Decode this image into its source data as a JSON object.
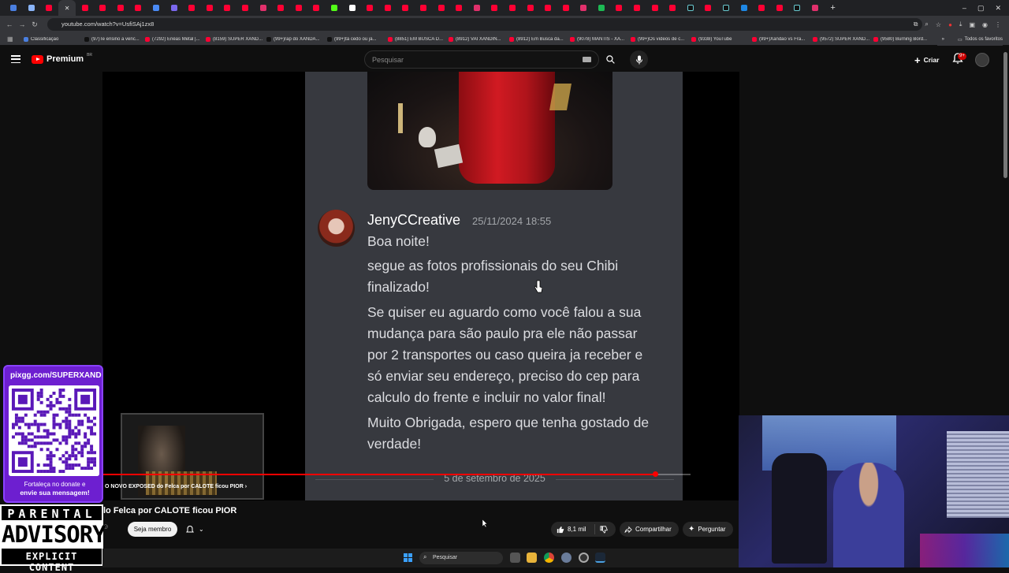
{
  "browser": {
    "tabs": [
      "chrome",
      "bm",
      "yt",
      "close",
      "yt",
      "yt",
      "yt",
      "yt",
      "doc",
      "insta",
      "yt",
      "yt",
      "yt",
      "yt",
      "ig",
      "yt",
      "yt",
      "yt",
      "k",
      "white",
      "yt",
      "yt",
      "yt",
      "yt",
      "yt",
      "yt",
      "ig",
      "yt",
      "yt",
      "yt",
      "yt",
      "yt",
      "ig",
      "green",
      "yt",
      "yt",
      "yt",
      "yt",
      "tiktok",
      "yt",
      "tiktok",
      "blue",
      "yt",
      "yt",
      "tiktok",
      "ig"
    ],
    "new_tab_label": "+",
    "window_controls": [
      "–",
      "▢",
      "✕"
    ],
    "url": "youtube.com/watch?v=UsfiSAj1zx8",
    "bookmarks": [
      "Classificação",
      "(97)Te ensino a venc...",
      "(7292) Enéas Metal |...",
      "(8159) SUPER XAND...",
      "(99+)rap do XANDÃ...",
      "(99+)tá cedo ou já...",
      "(8851) EM BUSCA D...",
      "(8912) VAI XANDIN...",
      "(8912) Em Busca da...",
      "(9078) MANTIS - XA...",
      "(99+)Os vídeos de c...",
      "(9338) YouTube",
      "(99+)Xandão vs Fra...",
      "(9572) SUPER XAND...",
      "(9580) Burning Bord..."
    ],
    "all_bookmarks": "Todos os favoritos"
  },
  "youtube": {
    "logo_text": "Premium",
    "logo_region": "BR",
    "search_placeholder": "Pesquisar",
    "create_label": "Criar",
    "notification_badge": "9+"
  },
  "video": {
    "chat": {
      "username": "JenyCCreative",
      "timestamp": "25/11/2024 18:55",
      "lines": [
        "Boa noite!",
        "segue as fotos profissionais do seu Chibi",
        "finalizado!",
        "Se quiser eu aguardo como você falou a sua",
        "mudança para são paulo pra ele não passar",
        "por 2 transportes ou caso queira ja receber e",
        "só enviar seu endereço, preciso do cep para",
        "calculo do frente e incluir no valor final!",
        "Muito Obrigada, espero que tenha gostado de",
        "verdade!"
      ],
      "date_separator": "5 de setembro de 2025"
    },
    "progress_fraction": 0.94,
    "endscreen_title": "O NOVO EXPOSED do Felca por CALOTE ficou PIOR",
    "title": "lo Felca por CALOTE ficou PIOR",
    "join_label": "Seja membro",
    "likes": "8,1 mil",
    "share_label": "Compartilhar",
    "ask_label": "Perguntar"
  },
  "overlays": {
    "pix_url": "pixgg.com/SUPERXANDA",
    "pix_caption_1": "Fortaleça no donate e",
    "pix_caption_2": "envie sua mensagem!",
    "advisory_top": "PARENTAL",
    "advisory_middle": "ADVISORY",
    "advisory_bottom": "EXPLICIT CONTENT"
  },
  "taskbar": {
    "search_label": "Pesquisar"
  },
  "colors": {
    "youtube_red": "#ff0000",
    "chat_bg": "#37393f",
    "pix_purple": "#6d1fd0"
  }
}
